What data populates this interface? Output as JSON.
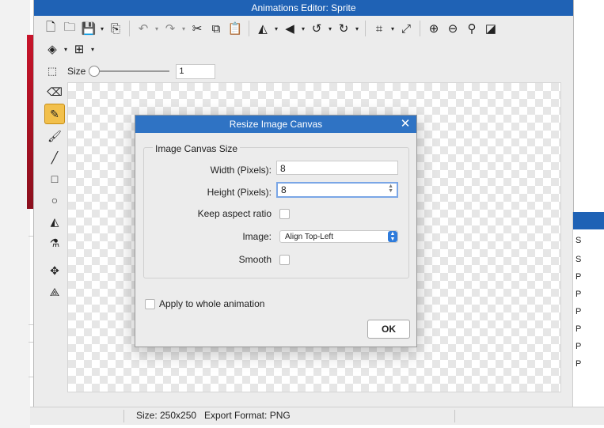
{
  "window": {
    "title": "Animations Editor: Sprite"
  },
  "toolbar_icons": [
    "new-icon",
    "open-folder-icon",
    "save-icon",
    "export-icon",
    "undo-icon",
    "redo-icon",
    "cut-icon",
    "copy-icon",
    "paste-icon",
    "flip-horizontal-icon",
    "flip-vertical-icon",
    "rotate-left-icon",
    "rotate-right-icon",
    "crop-icon",
    "resize-icon",
    "zoom-in-icon",
    "zoom-out-icon",
    "zoom-reset-icon",
    "invert-icon",
    "layers-icon",
    "grid-icon"
  ],
  "size_row": {
    "label": "Size",
    "value": "1"
  },
  "tools": [
    "eraser",
    "pencil",
    "brush",
    "line",
    "rectangle",
    "ellipse",
    "fill",
    "eyedropper",
    "move",
    "transform"
  ],
  "status": {
    "size": "Size: 250x250",
    "export": "Export Format: PNG"
  },
  "right_panel": {
    "letters": [
      "S",
      "S",
      "P",
      "P",
      "P",
      "P",
      "P",
      "P"
    ]
  },
  "dialog": {
    "title": "Resize Image Canvas",
    "group_label": "Image Canvas Size",
    "width_label": "Width (Pixels):",
    "width_value": "8",
    "height_label": "Height (Pixels):",
    "height_value": "8",
    "keep_aspect_label": "Keep aspect ratio",
    "image_label": "Image:",
    "image_option": "Align Top-Left",
    "smooth_label": "Smooth",
    "apply_all_label": "Apply to whole animation",
    "ok_label": "OK"
  },
  "colors": {
    "title_bar": "#1f62b5",
    "dialog_title": "#2f73c4",
    "active_tool": "#f2c04c",
    "select_arrow": "#2e7bdb"
  }
}
